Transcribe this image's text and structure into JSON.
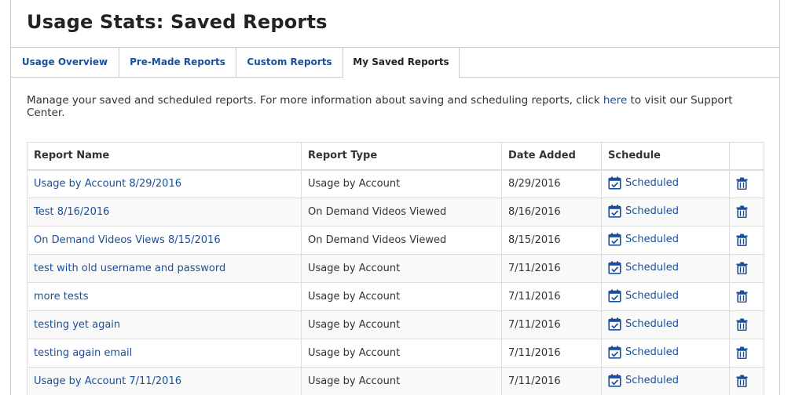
{
  "page": {
    "title": "Usage Stats: Saved Reports"
  },
  "tabs": [
    {
      "label": "Usage Overview"
    },
    {
      "label": "Pre-Made Reports"
    },
    {
      "label": "Custom Reports"
    },
    {
      "label": "My Saved Reports"
    }
  ],
  "intro": {
    "text_before": "Manage your saved and scheduled reports. For more information about saving and scheduling reports, click ",
    "link": "here",
    "text_after": " to visit our Support Center."
  },
  "table": {
    "headers": {
      "name": "Report Name",
      "type": "Report Type",
      "date": "Date Added",
      "schedule": "Schedule"
    },
    "rows": [
      {
        "name": "Usage by Account 8/29/2016",
        "type": "Usage by Account",
        "date": "8/29/2016",
        "schedule": "Scheduled"
      },
      {
        "name": "Test 8/16/2016",
        "type": "On Demand Videos Viewed",
        "date": "8/16/2016",
        "schedule": "Scheduled"
      },
      {
        "name": "On Demand Videos Views 8/15/2016",
        "type": "On Demand Videos Viewed",
        "date": "8/15/2016",
        "schedule": "Scheduled"
      },
      {
        "name": "test with old username and password",
        "type": "Usage by Account",
        "date": "7/11/2016",
        "schedule": "Scheduled"
      },
      {
        "name": "more tests",
        "type": "Usage by Account",
        "date": "7/11/2016",
        "schedule": "Scheduled"
      },
      {
        "name": "testing yet again",
        "type": "Usage by Account",
        "date": "7/11/2016",
        "schedule": "Scheduled"
      },
      {
        "name": "testing again email",
        "type": "Usage by Account",
        "date": "7/11/2016",
        "schedule": "Scheduled"
      },
      {
        "name": "Usage by Account 7/11/2016",
        "type": "Usage by Account",
        "date": "7/11/2016",
        "schedule": "Scheduled"
      }
    ]
  },
  "icons": {
    "schedule": "calendar-check-icon",
    "delete": "trash-icon"
  },
  "colors": {
    "link": "#1a4f9c",
    "border": "#cccccc",
    "title": "#222222"
  }
}
